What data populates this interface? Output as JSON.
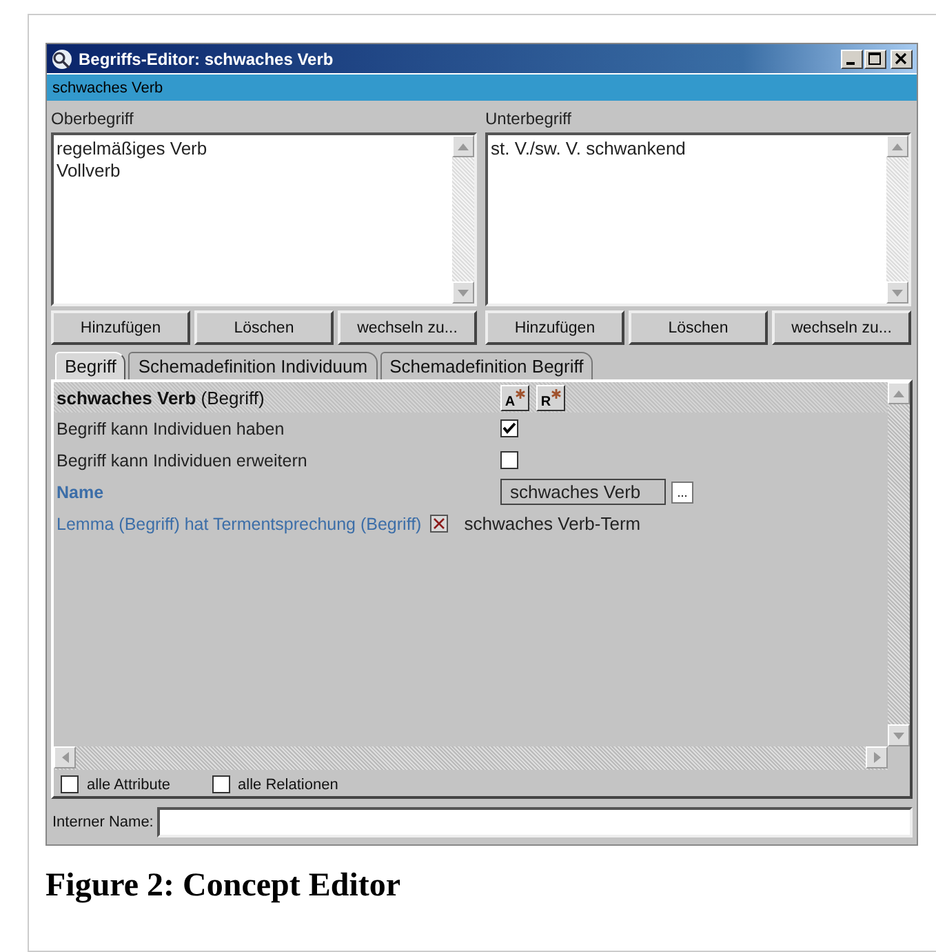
{
  "window": {
    "title": "Begriffs-Editor: schwaches Verb",
    "subtitle": "schwaches Verb"
  },
  "panes": [
    {
      "label": "Oberbegriff",
      "items": [
        "regelmäßiges Verb",
        "Vollverb"
      ],
      "buttons": [
        "Hinzufügen",
        "Löschen",
        "wechseln zu..."
      ]
    },
    {
      "label": "Unterbegriff",
      "items": [
        "st. V./sw. V. schwankend"
      ],
      "buttons": [
        "Hinzufügen",
        "Löschen",
        "wechseln zu..."
      ]
    }
  ],
  "tabs": [
    {
      "label": "Begriff",
      "selected": true
    },
    {
      "label": "Schemadefinition Individuum",
      "selected": false
    },
    {
      "label": "Schemadefinition Begriff",
      "selected": false
    }
  ],
  "editor": {
    "header": {
      "name": "schwaches Verb",
      "type": "(Begriff)",
      "buttons": [
        "A",
        "R"
      ]
    },
    "props": [
      {
        "kind": "checkbox",
        "label": "Begriff kann Individuen haben",
        "checked": true
      },
      {
        "kind": "checkbox",
        "label": "Begriff kann Individuen erweitern",
        "checked": false
      },
      {
        "kind": "field",
        "label": "Name",
        "value": "schwaches Verb",
        "browse": "..."
      },
      {
        "kind": "relation",
        "label": "Lemma (Begriff) hat Termentsprechung (Begriff)",
        "value": "schwaches Verb-Term"
      }
    ]
  },
  "options": [
    {
      "label": "alle Attribute",
      "checked": false
    },
    {
      "label": "alle Relationen",
      "checked": false
    }
  ],
  "internal_name": {
    "label": "Interner Name:"
  },
  "caption": "Figure 2: Concept Editor"
}
